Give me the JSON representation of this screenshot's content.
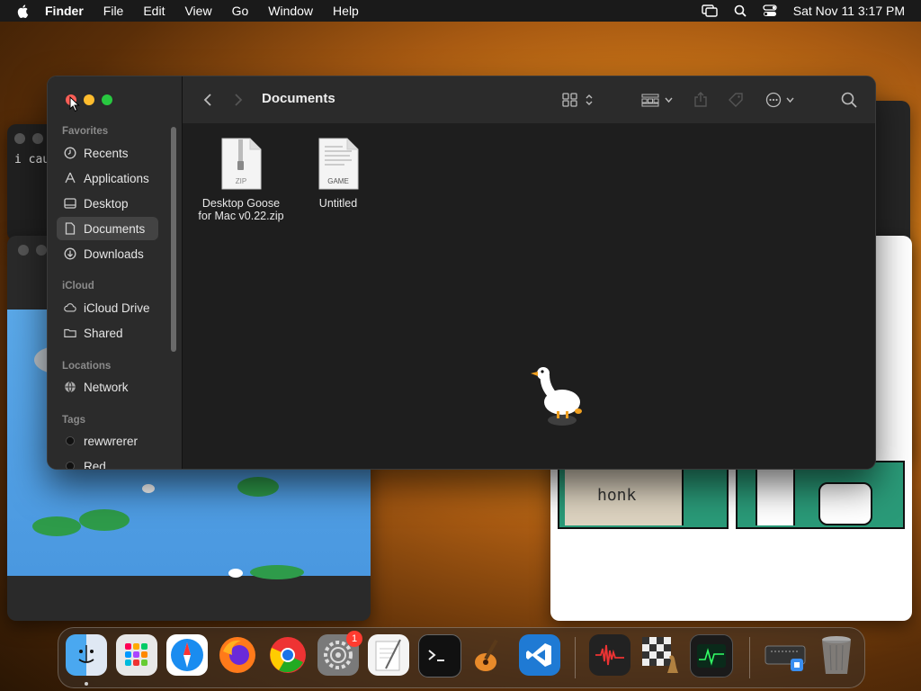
{
  "menubar": {
    "app_name": "Finder",
    "items": [
      "File",
      "Edit",
      "View",
      "Go",
      "Window",
      "Help"
    ],
    "clock": "Sat Nov 11  3:17 PM"
  },
  "terminal": {
    "text": "i cau"
  },
  "comic": {
    "sign_text": "honk"
  },
  "finder": {
    "title": "Documents",
    "sidebar": {
      "favorites_label": "Favorites",
      "favorites": [
        "Recents",
        "Applications",
        "Desktop",
        "Documents",
        "Downloads"
      ],
      "icloud_label": "iCloud",
      "icloud": [
        "iCloud Drive",
        "Shared"
      ],
      "locations_label": "Locations",
      "locations": [
        "Network"
      ],
      "tags_label": "Tags",
      "tags": [
        "rewwrerer",
        "Red"
      ]
    },
    "files": [
      {
        "name": "Desktop Goose for Mac v0.22.zip",
        "line1": "Desktop Goose",
        "line2": "for Mac v0.22.zip",
        "badge": "ZIP"
      },
      {
        "name": "Untitled",
        "line1": "Untitled",
        "line2": "",
        "badge": "GAME"
      }
    ]
  },
  "dock": {
    "apps": [
      "finder",
      "launchpad",
      "safari",
      "firefox",
      "chrome",
      "system-settings",
      "textedit",
      "terminal",
      "garageband",
      "vscode",
      "audio",
      "chess",
      "activity-monitor",
      "downloads-stack",
      "trash"
    ],
    "system_settings_badge": "1"
  },
  "colors": {
    "accent": "#28c840",
    "close": "#ff5f57",
    "minimize": "#febc2e"
  }
}
